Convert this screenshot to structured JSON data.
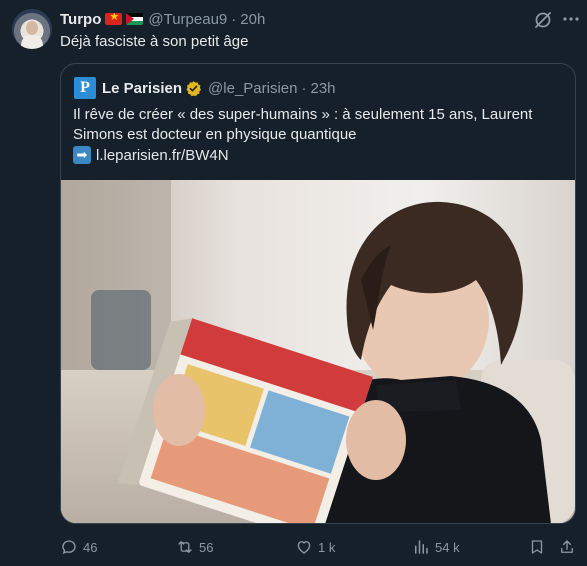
{
  "tweet": {
    "author_name": "Turpo",
    "handle": "@Turpeau9",
    "separator": "·",
    "time": "20h",
    "text": "Déjà fasciste à son petit âge",
    "flags": [
      "vietnam-flag",
      "palestine-flag"
    ]
  },
  "quoted": {
    "logo_letter": "P",
    "author_name": "Le Parisien",
    "handle": "@le_Parisien",
    "separator": "·",
    "time": "23h",
    "text": "Il rêve de créer « des super-humains » : à seulement 15 ans, Laurent Simons est docteur en physique quantique",
    "link_arrow": "➡",
    "link": "l.leparisien.fr/BW4N",
    "image": "boy-reading-comic-photo"
  },
  "actions": {
    "replies": "46",
    "reposts": "56",
    "likes": "1 k",
    "views": "54 k"
  },
  "colors": {
    "background": "#15202b",
    "text": "#e7e9ea",
    "muted": "#8b98a5",
    "border": "#38444d",
    "verified_gold": "#e2b719",
    "parisien_blue": "#2d8cd6"
  }
}
